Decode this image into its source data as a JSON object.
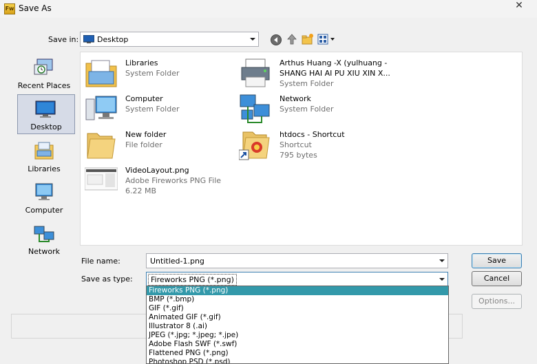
{
  "window": {
    "title": "Save As",
    "app_icon_text": "Fw"
  },
  "savein": {
    "label": "Save in:",
    "value": "Desktop"
  },
  "places": [
    {
      "label": "Recent Places",
      "icon": "recent-places-icon"
    },
    {
      "label": "Desktop",
      "icon": "desktop-icon",
      "selected": true
    },
    {
      "label": "Libraries",
      "icon": "libraries-icon"
    },
    {
      "label": "Computer",
      "icon": "computer-icon"
    },
    {
      "label": "Network",
      "icon": "network-icon"
    }
  ],
  "files": [
    {
      "name": "Libraries",
      "sub1": "System Folder",
      "sub2": ""
    },
    {
      "name": "Arthus Huang -X (yulhuang -",
      "name2": "SHANG HAI AI PU XIU XIN X...",
      "sub1": "System Folder"
    },
    {
      "name": "Computer",
      "sub1": "System Folder"
    },
    {
      "name": "Network",
      "sub1": "System Folder"
    },
    {
      "name": "New folder",
      "sub1": "File folder"
    },
    {
      "name": "htdocs - Shortcut",
      "sub1": "Shortcut",
      "sub2": "795 bytes"
    },
    {
      "name": "VideoLayout.png",
      "sub1": "Adobe Fireworks PNG File",
      "sub2": "6.22 MB"
    }
  ],
  "filename": {
    "label": "File name:",
    "value": "Untitled-1.png"
  },
  "savetype": {
    "label": "Save as type:",
    "value": "Fireworks PNG (*.png)",
    "options": [
      "Fireworks PNG (*.png)",
      "BMP (*.bmp)",
      "GIF (*.gif)",
      "Animated GIF (*.gif)",
      "Illustrator 8 (.ai)",
      "JPEG (*.jpg; *.jpeg; *.jpe)",
      "Adobe Flash SWF (*.swf)",
      "Flattened PNG (*.png)",
      "Photoshop PSD (*.psd)"
    ]
  },
  "buttons": {
    "save": "Save",
    "cancel": "Cancel",
    "options": "Options..."
  }
}
